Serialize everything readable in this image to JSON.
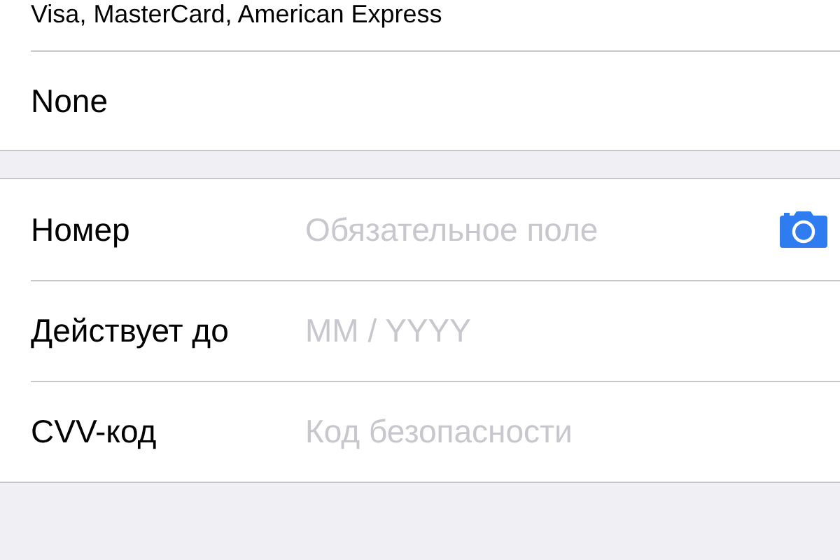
{
  "card_types": {
    "text": "Visa, MasterCard, American Express"
  },
  "options": [
    {
      "label": "None"
    }
  ],
  "card_fields": [
    {
      "label": "Номер",
      "placeholder": "Обязательное поле",
      "camera": true
    },
    {
      "label": "Действует до",
      "placeholder": "MM / YYYY",
      "camera": false
    },
    {
      "label": "CVV-код",
      "placeholder": "Код безопасности",
      "camera": false
    }
  ]
}
